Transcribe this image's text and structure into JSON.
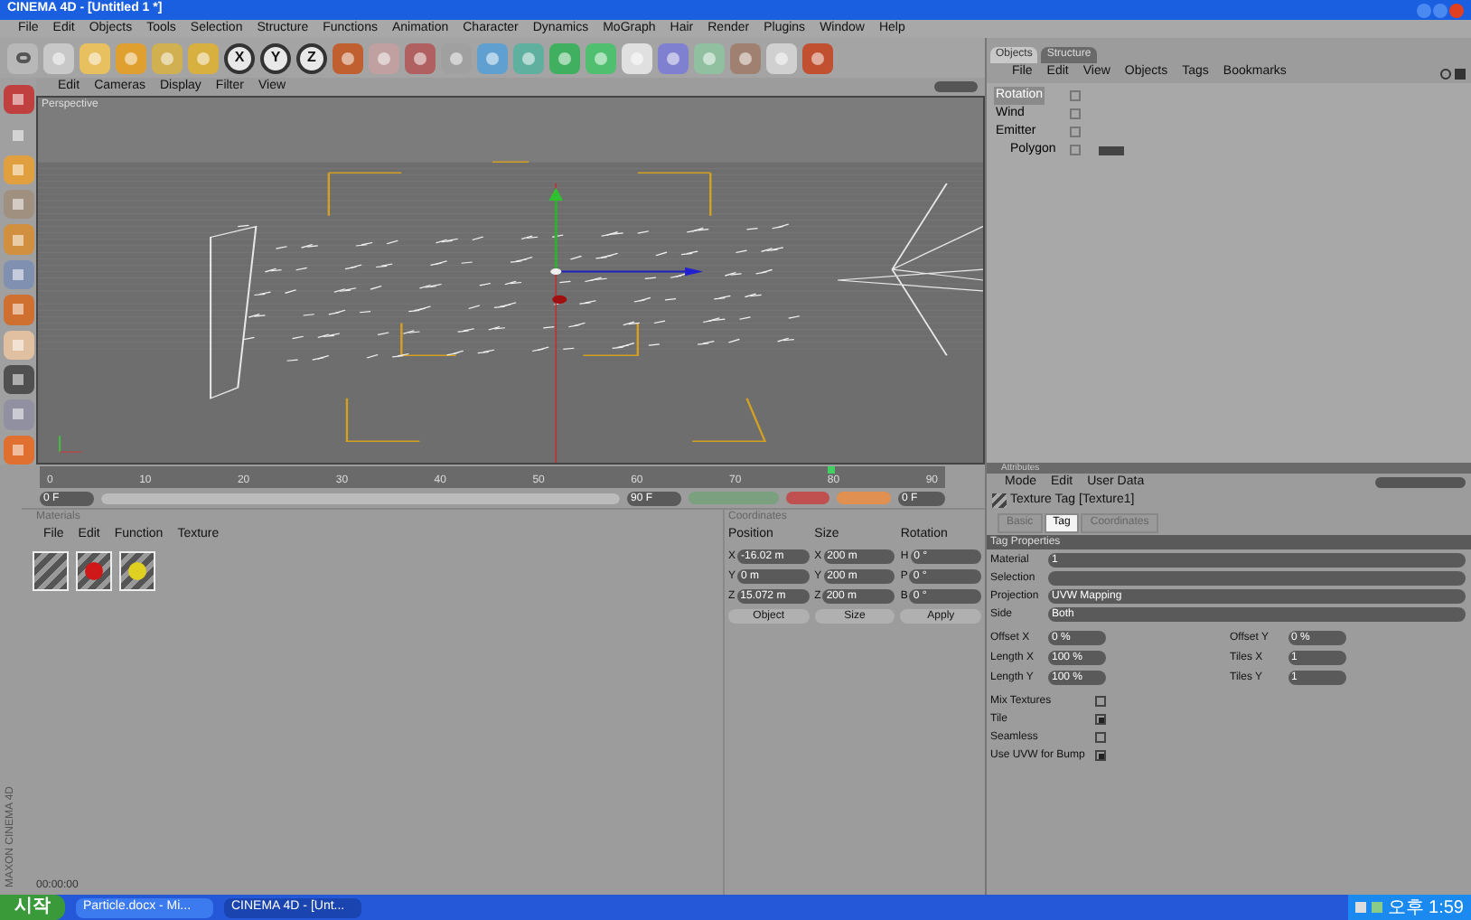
{
  "window": {
    "title": "CINEMA 4D - [Untitled 1 *]"
  },
  "menu": [
    "File",
    "Edit",
    "Objects",
    "Tools",
    "Selection",
    "Structure",
    "Functions",
    "Animation",
    "Character",
    "Dynamics",
    "MoGraph",
    "Hair",
    "Render",
    "Plugins",
    "Window",
    "Help"
  ],
  "axis_buttons": [
    "X",
    "Y",
    "Z"
  ],
  "viewport": {
    "menu": [
      "Edit",
      "Cameras",
      "Display",
      "Filter",
      "View"
    ],
    "label": "Perspective"
  },
  "object_manager": {
    "tabs": [
      {
        "label": "Objects",
        "selected": true
      },
      {
        "label": "Structure",
        "selected": false
      }
    ],
    "menu": [
      "File",
      "Edit",
      "View",
      "Objects",
      "Tags",
      "Bookmarks"
    ],
    "objects": [
      {
        "name": "Rotation",
        "selected": true
      },
      {
        "name": "Wind",
        "selected": false
      },
      {
        "name": "Emitter",
        "selected": false,
        "children": [
          {
            "name": "Polygon",
            "selected": false
          }
        ]
      }
    ]
  },
  "attributes": {
    "title": "Attributes",
    "menu": [
      "Mode",
      "Edit",
      "User Data"
    ],
    "object_title": "Texture Tag [Texture1]",
    "tabs": [
      {
        "label": "Basic",
        "selected": false
      },
      {
        "label": "Tag",
        "selected": true
      },
      {
        "label": "Coordinates",
        "selected": false
      }
    ],
    "section": "Tag Properties",
    "fields": [
      {
        "label": "Material",
        "value": "1"
      },
      {
        "label": "Selection"
      },
      {
        "label": "Projection",
        "value": "UVW Mapping"
      },
      {
        "label": "Side",
        "value": "Both"
      }
    ],
    "pairs": [
      {
        "label": "Offset X",
        "value": "0 %"
      },
      {
        "label": "Offset Y",
        "value": "0 %"
      },
      {
        "label": "Length X",
        "value": "100 %"
      },
      {
        "label": "Tiles X",
        "value": "1"
      },
      {
        "label": "Length Y",
        "value": "100 %"
      },
      {
        "label": "Tiles Y",
        "value": "1"
      }
    ],
    "checks": [
      {
        "label": "Mix Textures",
        "checked": false
      },
      {
        "label": "Tile",
        "checked": true
      },
      {
        "label": "Seamless",
        "checked": false
      },
      {
        "label": "Use UVW for Bump",
        "checked": true
      }
    ]
  },
  "timeline": {
    "ticks": [
      "0",
      "10",
      "20",
      "30",
      "40",
      "50",
      "60",
      "70",
      "80",
      "90"
    ],
    "frame": "0 F",
    "start": "0 F",
    "end": "90 F",
    "level": 0.87,
    "range": {
      "level": 1
    }
  },
  "materials": {
    "title": "Materials",
    "menu": [
      "File",
      "Edit",
      "Function",
      "Texture"
    ],
    "items": [
      {
        "kind": "empty"
      },
      {
        "kind": "sphere",
        "color": "#d01818"
      },
      {
        "kind": "sphere",
        "color": "#e0d020"
      }
    ]
  },
  "coordinates": {
    "title": "Coordinates",
    "headers": [
      "Position",
      "Size",
      "Rotation"
    ],
    "rows": [
      {
        "axis": "X",
        "position": "-16.02 m",
        "size_axis": "X",
        "size": "200 m",
        "rot_axis": "H",
        "rotation": "0 °"
      },
      {
        "axis": "Y",
        "position": "0 m",
        "size_axis": "Y",
        "size": "200 m",
        "rot_axis": "P",
        "rotation": "0 °"
      },
      {
        "axis": "Z",
        "position": "15.072 m",
        "size_axis": "Z",
        "size": "200 m",
        "rot_axis": "B",
        "rotation": "0 °"
      }
    ],
    "buttons": [
      "Object",
      "Size",
      "Apply"
    ]
  },
  "side_logo": "MAXON CINEMA 4D",
  "status": "00:00:00",
  "taskbar": {
    "start": "시작",
    "items": [
      {
        "label": "Particle.docx - Mi...",
        "selected": false
      },
      {
        "label": "CINEMA 4D - [Unt...",
        "selected": true
      }
    ],
    "clock": "오후 1:59"
  }
}
